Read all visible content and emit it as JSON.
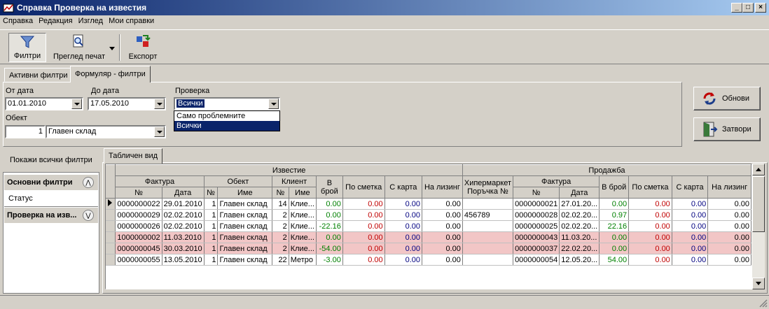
{
  "window": {
    "title": "Справка Проверка на известия"
  },
  "menu": [
    "Справка",
    "Редакция",
    "Изглед",
    "Мои справки"
  ],
  "toolbar": {
    "filters": "Филтри",
    "print_preview": "Преглед печат",
    "export": "Експорт"
  },
  "tabs": {
    "active_filters": "Активни филтри",
    "form_filters": "Формуляр - филтри",
    "table_view": "Табличен вид"
  },
  "filters": {
    "from_date_label": "От дата",
    "from_date": "01.01.2010",
    "to_date_label": "До дата",
    "to_date": "17.05.2010",
    "check_label": "Проверка",
    "check_value": "Всички",
    "check_options": [
      "Само проблемните",
      "Всички"
    ],
    "object_label": "Обект",
    "object_id": "1",
    "object_name": "Главен склад"
  },
  "buttons": {
    "refresh": "Обнови",
    "close": "Затвори"
  },
  "sidebar": {
    "show_all": "Покажи всички филтри",
    "basic_filters": "Основни филтри",
    "status": "Статус",
    "notice_check": "Проверка на изв..."
  },
  "grid": {
    "groups": {
      "notice": "Известие",
      "sale": "Продажба"
    },
    "sub": {
      "invoice": "Фактура",
      "object": "Обект",
      "client": "Клиент",
      "invoice2": "Фактура"
    },
    "cols": {
      "no": "№",
      "date": "Дата",
      "obj_no": "№",
      "obj_name": "Име",
      "cl_no": "№",
      "cl_name": "Име",
      "qty": "В брой",
      "account": "По сметка",
      "card": "С карта",
      "leasing": "На лизинг",
      "hyper": "Хипермаркет Поръчка №",
      "s_no": "№",
      "s_date": "Дата",
      "s_qty": "В брой",
      "s_account": "По сметка",
      "s_card": "С карта",
      "s_leasing": "На лизинг"
    },
    "rows": [
      {
        "no": "0000000022",
        "date": "29.01.2010",
        "on": "1",
        "oname": "Главен склад",
        "cn": "14",
        "cname": "Клие...",
        "qty": "0.00",
        "acc": "0.00",
        "card": "0.00",
        "lease": "0.00",
        "hyper": "",
        "sno": "0000000021",
        "sdate": "27.01.20...",
        "sqty": "0.00",
        "sacc": "0.00",
        "scard": "0.00",
        "slease": "0.00",
        "pink": false,
        "current": true
      },
      {
        "no": "0000000029",
        "date": "02.02.2010",
        "on": "1",
        "oname": "Главен склад",
        "cn": "2",
        "cname": "Клие...",
        "qty": "0.00",
        "acc": "0.00",
        "card": "0.00",
        "lease": "0.00",
        "hyper": "456789",
        "sno": "0000000028",
        "sdate": "02.02.20...",
        "sqty": "0.97",
        "sacc": "0.00",
        "scard": "0.00",
        "slease": "0.00",
        "pink": false
      },
      {
        "no": "0000000026",
        "date": "02.02.2010",
        "on": "1",
        "oname": "Главен склад",
        "cn": "2",
        "cname": "Клие...",
        "qty": "-22.16",
        "acc": "0.00",
        "card": "0.00",
        "lease": "0.00",
        "hyper": "",
        "sno": "0000000025",
        "sdate": "02.02.20...",
        "sqty": "22.16",
        "sacc": "0.00",
        "scard": "0.00",
        "slease": "0.00",
        "pink": false
      },
      {
        "no": "1000000002",
        "date": "11.03.2010",
        "on": "1",
        "oname": "Главен склад",
        "cn": "2",
        "cname": "Клие...",
        "qty": "0.00",
        "acc": "0.00",
        "card": "0.00",
        "lease": "0.00",
        "hyper": "",
        "sno": "0000000043",
        "sdate": "11.03.20...",
        "sqty": "0.00",
        "sacc": "0.00",
        "scard": "0.00",
        "slease": "0.00",
        "pink": true
      },
      {
        "no": "0000000045",
        "date": "30.03.2010",
        "on": "1",
        "oname": "Главен склад",
        "cn": "2",
        "cname": "Клие...",
        "qty": "-54.00",
        "acc": "0.00",
        "card": "0.00",
        "lease": "0.00",
        "hyper": "",
        "sno": "0000000037",
        "sdate": "22.02.20...",
        "sqty": "0.00",
        "sacc": "0.00",
        "scard": "0.00",
        "slease": "0.00",
        "pink": true
      },
      {
        "no": "0000000055",
        "date": "13.05.2010",
        "on": "1",
        "oname": "Главен склад",
        "cn": "22",
        "cname": "Метро",
        "qty": "-3.00",
        "acc": "0.00",
        "card": "0.00",
        "lease": "0.00",
        "hyper": "",
        "sno": "0000000054",
        "sdate": "12.05.20...",
        "sqty": "54.00",
        "sacc": "0.00",
        "scard": "0.00",
        "slease": "0.00",
        "pink": false
      }
    ]
  }
}
